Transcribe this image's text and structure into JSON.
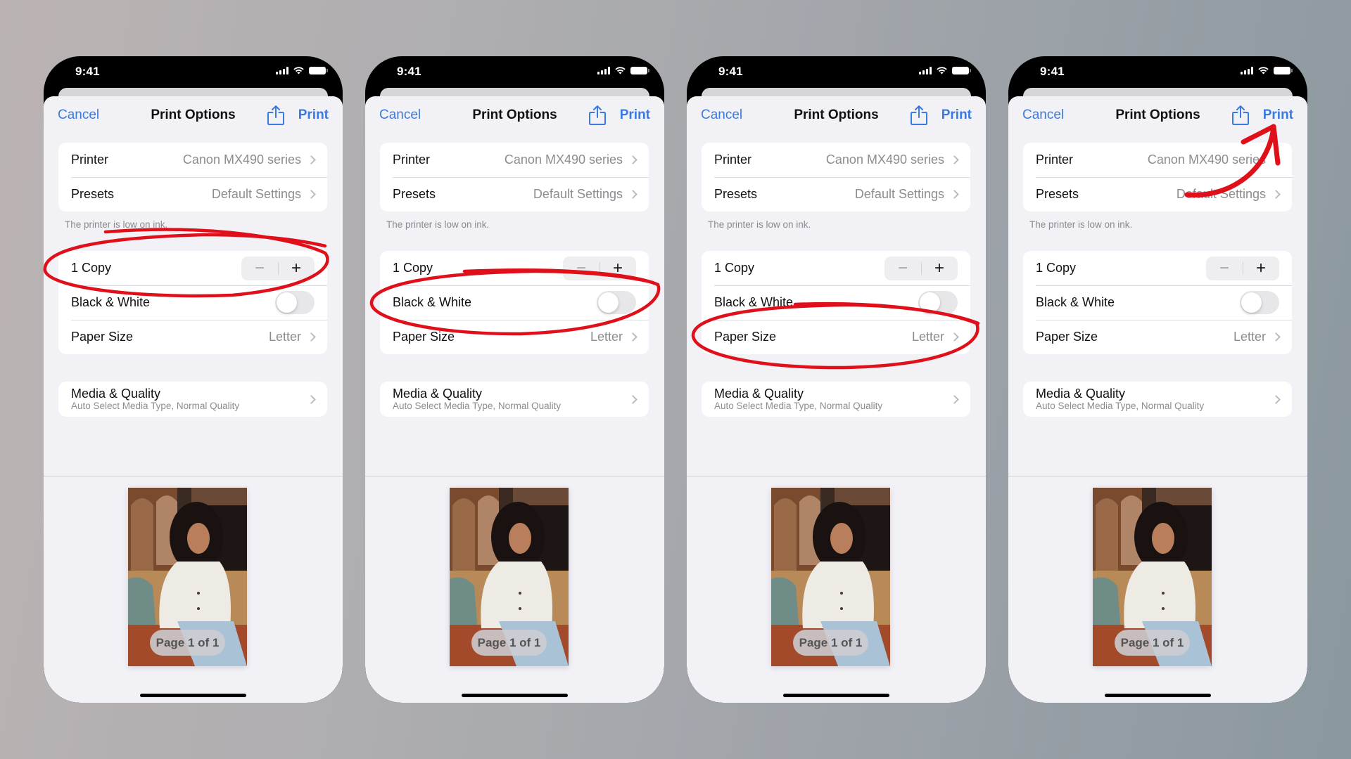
{
  "colors": {
    "accent": "#3a7ae0",
    "annotation": "#e0101a",
    "sheet_bg": "#f1f1f6"
  },
  "phones": [
    {
      "status": {
        "time": "9:41",
        "icons": [
          "cellular-signal-icon",
          "wifi-icon",
          "battery-icon"
        ]
      },
      "nav": {
        "cancel": "Cancel",
        "title": "Print Options",
        "share_icon": "share-icon",
        "print": "Print"
      },
      "printer_card": [
        {
          "label": "Printer",
          "value": "Canon MX490 series"
        },
        {
          "label": "Presets",
          "value": "Default Settings"
        }
      ],
      "footnote": "The printer is low on ink.",
      "options_card": {
        "copies_label": "1 Copy",
        "stepper": {
          "minus": "−",
          "plus": "+"
        },
        "bw_label": "Black & White",
        "bw_on": false,
        "paper_label": "Paper Size",
        "paper_value": "Letter"
      },
      "media": {
        "title": "Media & Quality",
        "subtitle": "Auto Select Media Type, Normal Quality"
      },
      "preview": {
        "page_label": "Page 1 of 1"
      },
      "highlight": "copies"
    },
    {
      "status": {
        "time": "9:41",
        "icons": [
          "cellular-signal-icon",
          "wifi-icon",
          "battery-icon"
        ]
      },
      "nav": {
        "cancel": "Cancel",
        "title": "Print Options",
        "share_icon": "share-icon",
        "print": "Print"
      },
      "printer_card": [
        {
          "label": "Printer",
          "value": "Canon MX490 series"
        },
        {
          "label": "Presets",
          "value": "Default Settings"
        }
      ],
      "footnote": "The printer is low on ink.",
      "options_card": {
        "copies_label": "1 Copy",
        "stepper": {
          "minus": "−",
          "plus": "+"
        },
        "bw_label": "Black & White",
        "bw_on": false,
        "paper_label": "Paper Size",
        "paper_value": "Letter"
      },
      "media": {
        "title": "Media & Quality",
        "subtitle": "Auto Select Media Type, Normal Quality"
      },
      "preview": {
        "page_label": "Page 1 of 1"
      },
      "highlight": "black-white"
    },
    {
      "status": {
        "time": "9:41",
        "icons": [
          "cellular-signal-icon",
          "wifi-icon",
          "battery-icon"
        ]
      },
      "nav": {
        "cancel": "Cancel",
        "title": "Print Options",
        "share_icon": "share-icon",
        "print": "Print"
      },
      "printer_card": [
        {
          "label": "Printer",
          "value": "Canon MX490 series"
        },
        {
          "label": "Presets",
          "value": "Default Settings"
        }
      ],
      "footnote": "The printer is low on ink.",
      "options_card": {
        "copies_label": "1 Copy",
        "stepper": {
          "minus": "−",
          "plus": "+"
        },
        "bw_label": "Black & White",
        "bw_on": false,
        "paper_label": "Paper Size",
        "paper_value": "Letter"
      },
      "media": {
        "title": "Media & Quality",
        "subtitle": "Auto Select Media Type, Normal Quality"
      },
      "preview": {
        "page_label": "Page 1 of 1"
      },
      "highlight": "paper-size"
    },
    {
      "status": {
        "time": "9:41",
        "icons": [
          "cellular-signal-icon",
          "wifi-icon",
          "battery-icon"
        ]
      },
      "nav": {
        "cancel": "Cancel",
        "title": "Print Options",
        "share_icon": "share-icon",
        "print": "Print"
      },
      "printer_card": [
        {
          "label": "Printer",
          "value": "Canon MX490 series"
        },
        {
          "label": "Presets",
          "value": "Default Settings"
        }
      ],
      "footnote": "The printer is low on ink.",
      "options_card": {
        "copies_label": "1 Copy",
        "stepper": {
          "minus": "−",
          "plus": "+"
        },
        "bw_label": "Black & White",
        "bw_on": false,
        "paper_label": "Paper Size",
        "paper_value": "Letter"
      },
      "media": {
        "title": "Media & Quality",
        "subtitle": "Auto Select Media Type, Normal Quality"
      },
      "preview": {
        "page_label": "Page 1 of 1"
      },
      "highlight": "print-button-arrow"
    }
  ]
}
